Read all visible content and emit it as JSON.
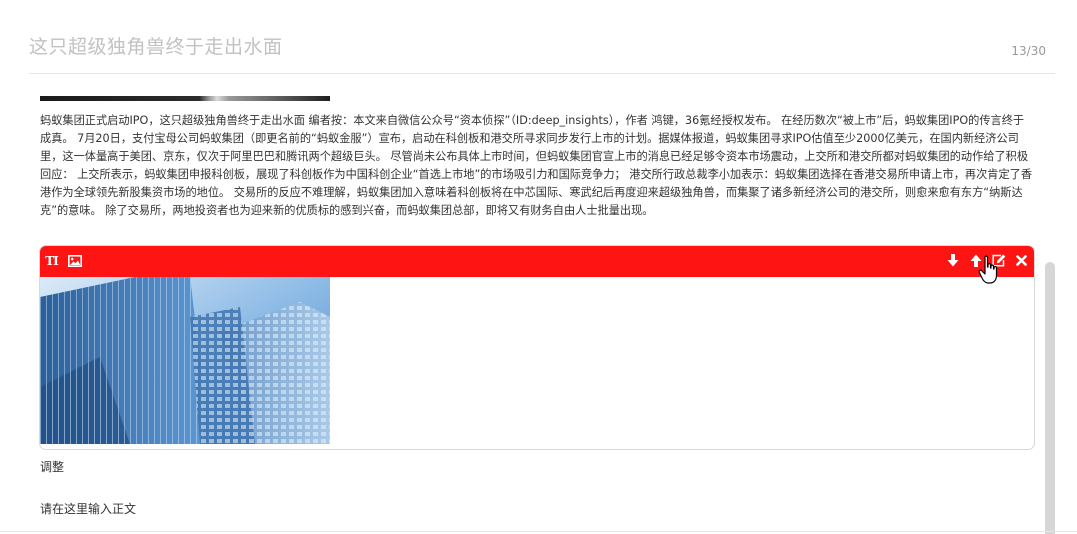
{
  "header": {
    "title": "这只超级独角兽终于走出水面",
    "counter": "13/30"
  },
  "article": {
    "paragraph": "蚂蚁集团正式启动IPO，这只超级独角兽终于走出水面 编者按：本文来自微信公众号“资本侦探”（ID:deep_insights），作者 鸿键，36氪经授权发布。 在经历数次“被上市”后，蚂蚁集团IPO的传言终于成真。 7月20日，支付宝母公司蚂蚁集团（即更名前的“蚂蚁金服”）宣布，启动在科创板和港交所寻求同步发行上市的计划。据媒体报道，蚂蚁集团寻求IPO估值至少2000亿美元，在国内新经济公司里，这一体量高于美团、京东，仅次于阿里巴巴和腾讯两个超级巨头。 尽管尚未公布具体上市时间，但蚂蚁集团官宣上市的消息已经足够令资本市场震动，上交所和港交所都对蚂蚁集团的动作给了积极回应： 上交所表示，蚂蚁集团申报科创板，展现了科创板作为中国科创企业“首选上市地”的市场吸引力和国际竞争力； 港交所行政总裁李小加表示：蚂蚁集团选择在香港交易所申请上市，再次肯定了香港作为全球领先新股集资市场的地位。 交易所的反应不难理解，蚂蚁集团加入意味着科创板将在中芯国际、寒武纪后再度迎来超级独角兽，而集聚了诸多新经济公司的港交所，则愈来愈有东方“纳斯达克”的意味。 除了交易所，两地投资者也为迎来新的优质标的感到兴奋，而蚂蚁集团总部，即将又有财务自由人士批量出现。",
    "image_caption": "调整",
    "body_placeholder": "请在这里输入正文"
  },
  "image_block": {
    "toolbar_color": "#ff1414",
    "left_tools": [
      {
        "icon": "text-icon",
        "glyph": "TI"
      },
      {
        "icon": "image-icon"
      }
    ],
    "right_tools": [
      {
        "icon": "arrow-down-icon"
      },
      {
        "icon": "arrow-up-icon"
      },
      {
        "icon": "edit-icon"
      },
      {
        "icon": "close-icon"
      }
    ],
    "photo": "building-photo"
  }
}
